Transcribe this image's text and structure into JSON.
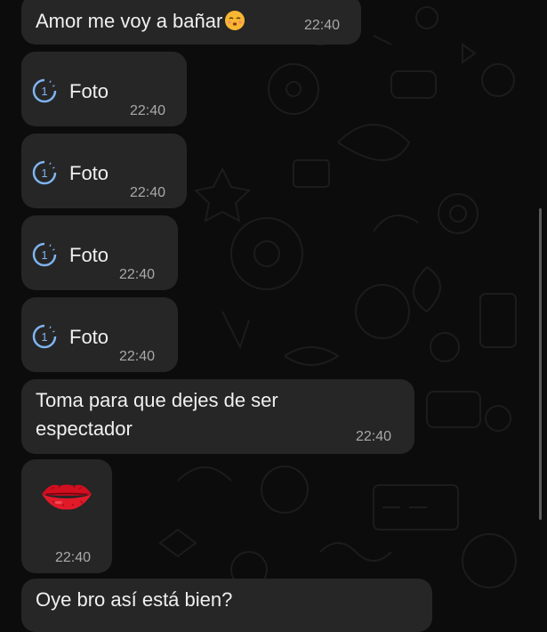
{
  "messages": [
    {
      "kind": "text",
      "text": "Amor me voy a bañar",
      "emoji": "kissing-face-closed-eyes",
      "time": "22:40"
    },
    {
      "kind": "photo",
      "label": "Foto",
      "icon": "view-once-1-icon",
      "time": "22:40"
    },
    {
      "kind": "photo",
      "label": "Foto",
      "icon": "view-once-1-icon",
      "time": "22:40"
    },
    {
      "kind": "photo",
      "label": "Foto",
      "icon": "view-once-1-icon",
      "time": "22:40"
    },
    {
      "kind": "photo",
      "label": "Foto",
      "icon": "view-once-1-icon",
      "time": "22:40"
    },
    {
      "kind": "text",
      "lines": [
        "Toma para que dejes de ser",
        "espectador"
      ],
      "time": "22:40"
    },
    {
      "kind": "sticker",
      "sticker": "red-lips-kiss",
      "time": "22:40"
    },
    {
      "kind": "text",
      "text": "Oye bro así está bien?"
    }
  ],
  "colors": {
    "background": "#0c0c0c",
    "bubble": "#262626",
    "text": "#f0f0f0",
    "time": "#a9a9a9",
    "accent": "#7fb4f0",
    "lips": "#d10f1f"
  }
}
